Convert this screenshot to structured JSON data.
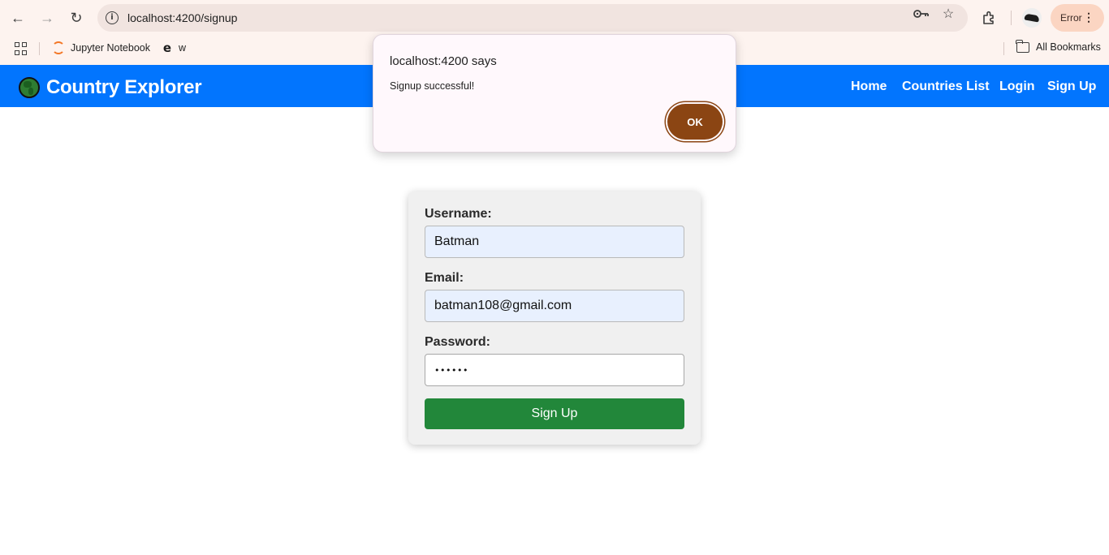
{
  "browser": {
    "url": "localhost:4200/signup",
    "profile_status": "Error",
    "bookmarks": [
      {
        "label": "Jupyter Notebook"
      },
      {
        "label": "w"
      }
    ],
    "all_bookmarks_label": "All Bookmarks"
  },
  "app": {
    "brand": "Country Explorer",
    "nav": [
      "Home",
      "Countries List",
      "Login",
      "Sign Up"
    ]
  },
  "form": {
    "username_label": "Username:",
    "username_value": "Batman",
    "email_label": "Email:",
    "email_value": "batman108@gmail.com",
    "password_label": "Password:",
    "password_value": "••••••",
    "submit_label": "Sign Up"
  },
  "dialog": {
    "title": "localhost:4200 says",
    "message": "Signup successful!",
    "ok_label": "OK"
  },
  "colors": {
    "header": "#0275fe",
    "submit": "#22873a",
    "ok_button": "#8b4513"
  }
}
